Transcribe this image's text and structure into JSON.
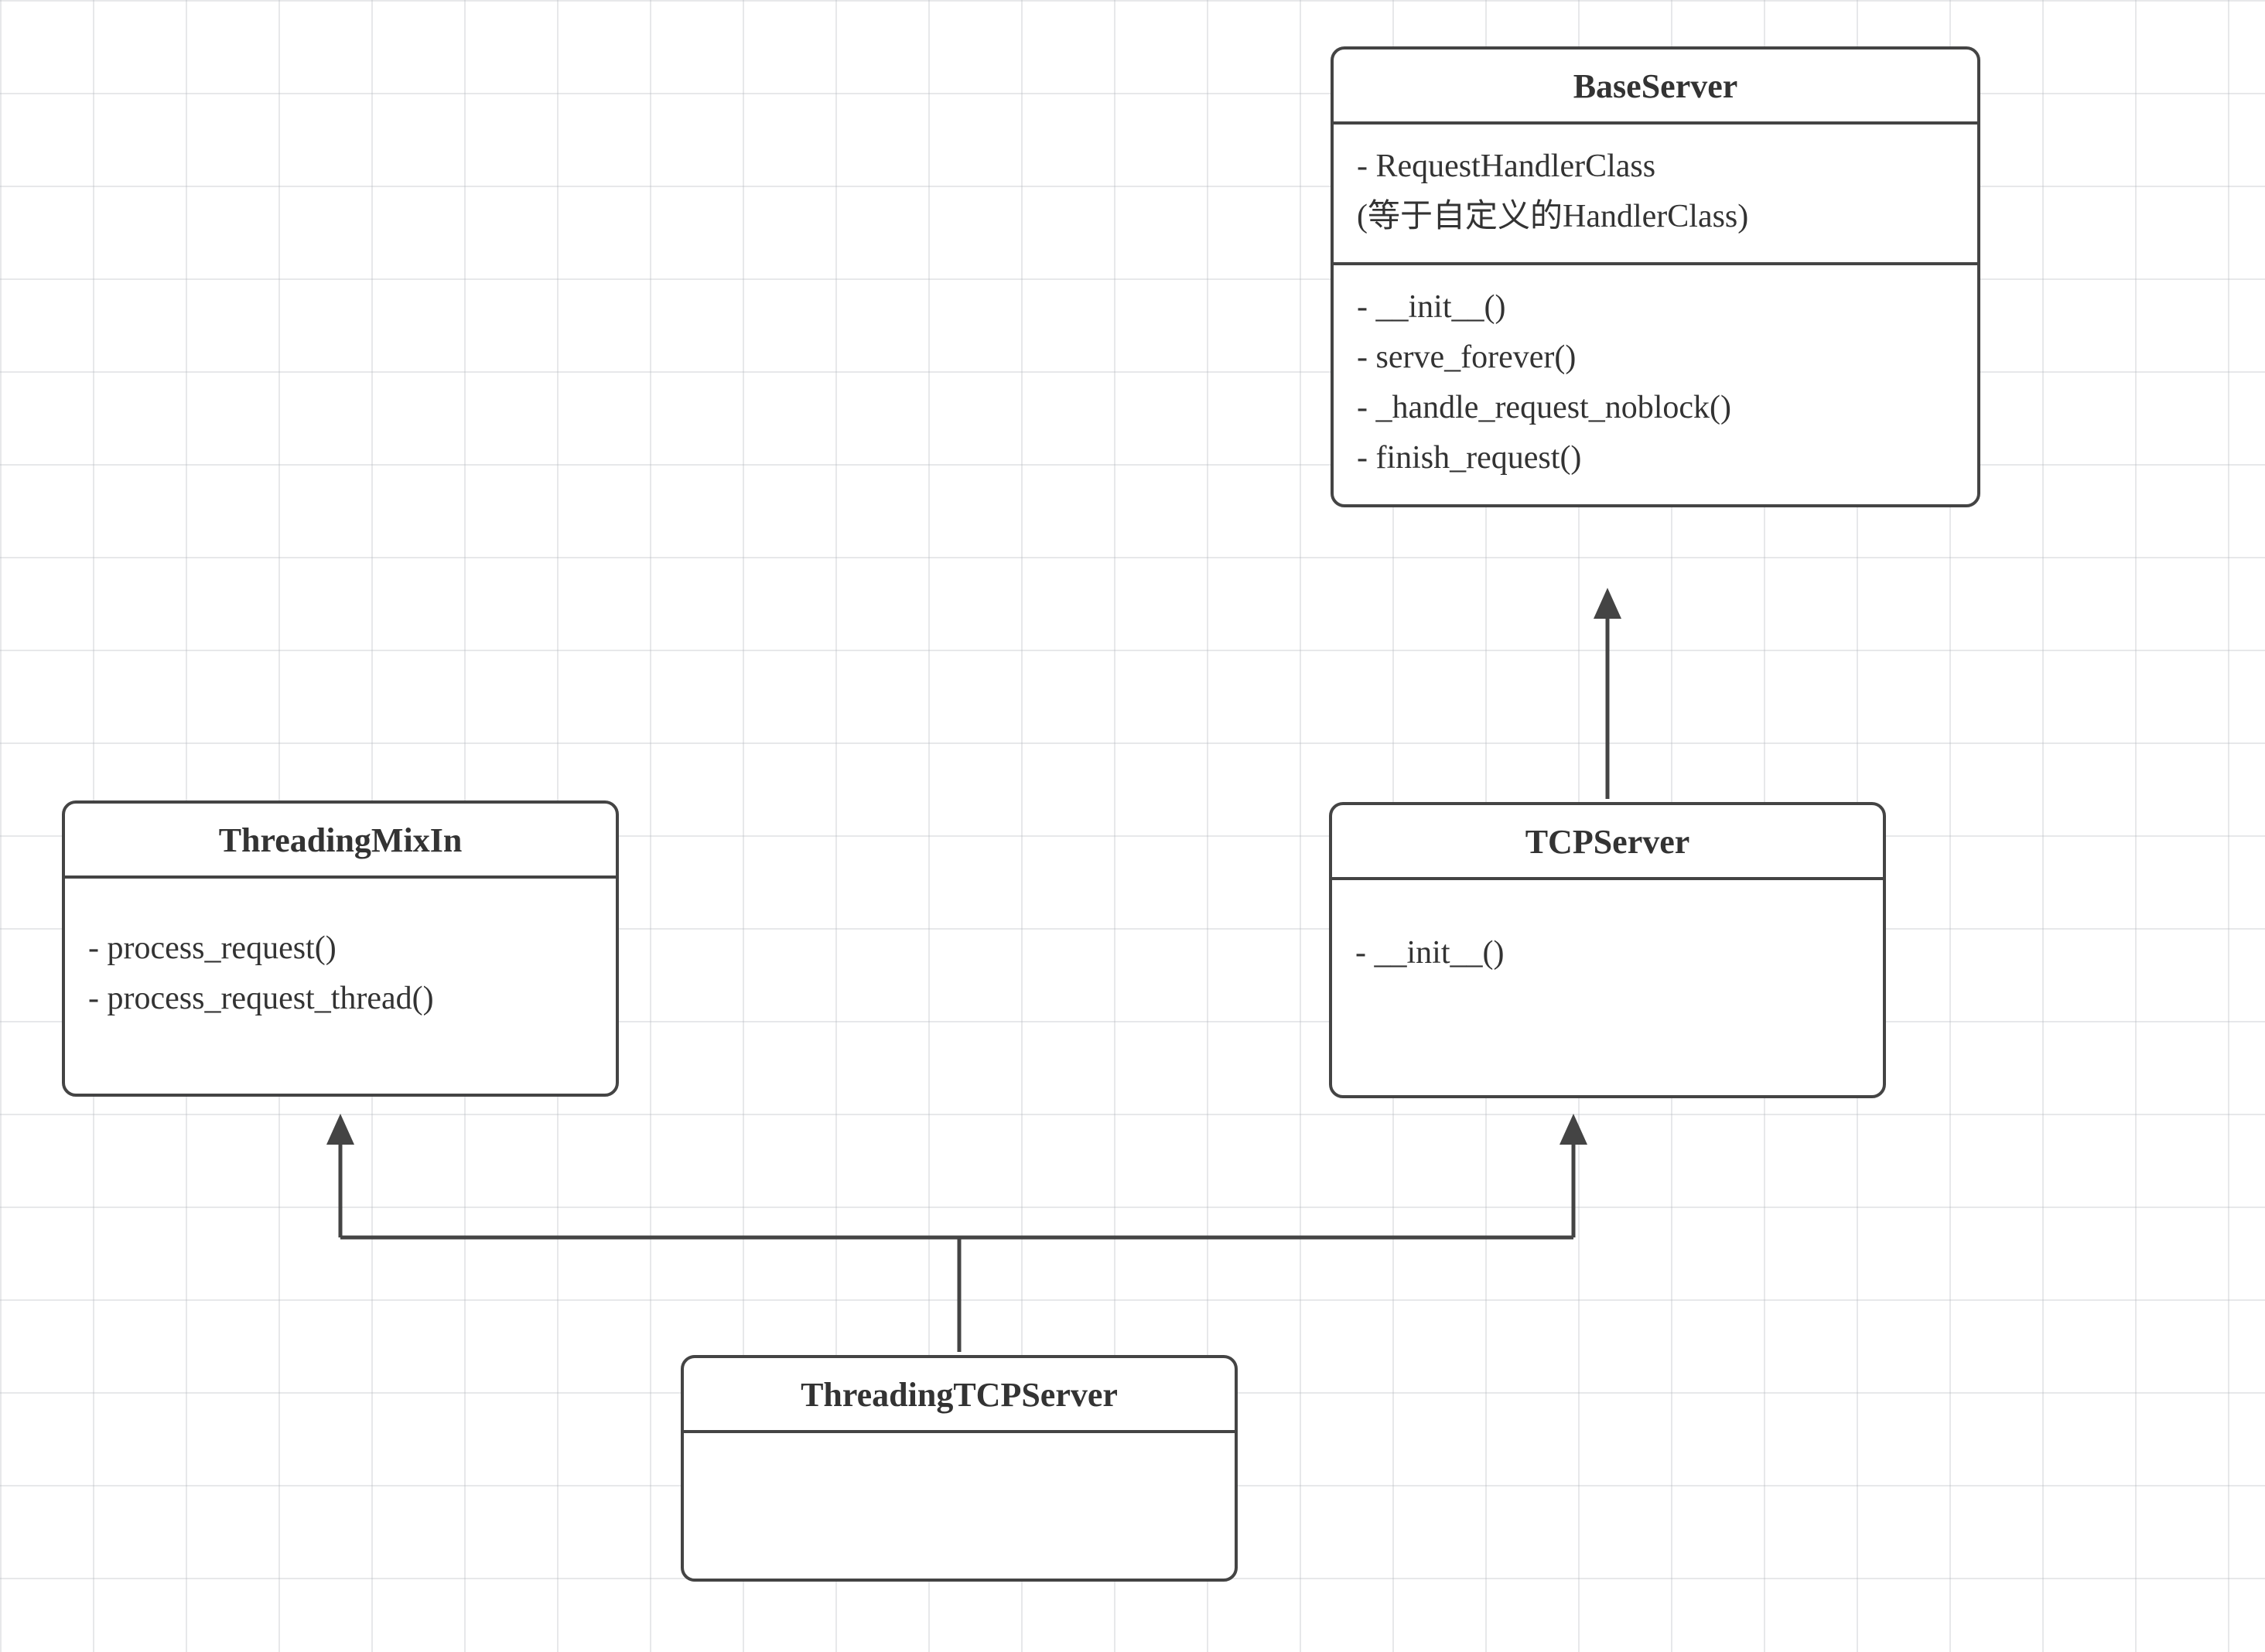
{
  "classes": {
    "baseServer": {
      "name": "BaseServer",
      "attributes": [
        "- RequestHandlerClass",
        "(等于自定义的HandlerClass)"
      ],
      "methods": [
        "- __init__()",
        "- serve_forever()",
        "- _handle_request_noblock()",
        "- finish_request()"
      ]
    },
    "tcpServer": {
      "name": "TCPServer",
      "attributes": [],
      "methods": [
        "- __init__()"
      ]
    },
    "threadingMixIn": {
      "name": "ThreadingMixIn",
      "attributes": [],
      "methods": [
        "- process_request()",
        "- process_request_thread()"
      ]
    },
    "threadingTCPServer": {
      "name": "ThreadingTCPServer",
      "attributes": [],
      "methods": []
    }
  },
  "relations": [
    {
      "from": "tcpServer",
      "to": "baseServer",
      "type": "inherits"
    },
    {
      "from": "threadingTCPServer",
      "to": "tcpServer",
      "type": "inherits"
    },
    {
      "from": "threadingTCPServer",
      "to": "threadingMixIn",
      "type": "inherits"
    }
  ]
}
